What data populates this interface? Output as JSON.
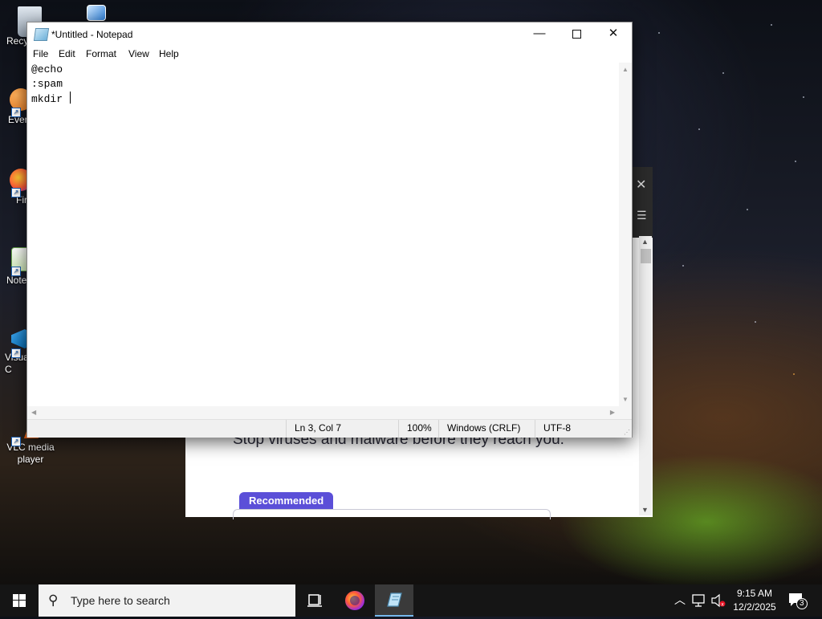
{
  "desktop": {
    "icons": [
      {
        "label": "Recy"
      },
      {
        "label": "Ever"
      },
      {
        "label": "Fir"
      },
      {
        "label": "Note"
      },
      {
        "label": "Visua\nC"
      },
      {
        "label": "VLC media\nplayer"
      }
    ]
  },
  "browser_window": {
    "headline": "Stop viruses and malware before they reach you.",
    "badge": "Recommended",
    "accent_color": "#5b4fd8"
  },
  "notepad": {
    "title": "*Untitled - Notepad",
    "menu": [
      "File",
      "Edit",
      "Format",
      "View",
      "Help"
    ],
    "lines": [
      "@echo",
      ":spam",
      "mkdir "
    ],
    "status": {
      "position": "Ln 3, Col 7",
      "zoom": "100%",
      "line_ending": "Windows (CRLF)",
      "encoding": "UTF-8"
    }
  },
  "taskbar": {
    "search_placeholder": "Type here to search",
    "apps": [
      "task-view-icon",
      "firefox-icon",
      "notepad-icon"
    ],
    "clock": {
      "time": "9:15 AM",
      "date": "12/2/2025"
    },
    "notification_count": "3"
  }
}
